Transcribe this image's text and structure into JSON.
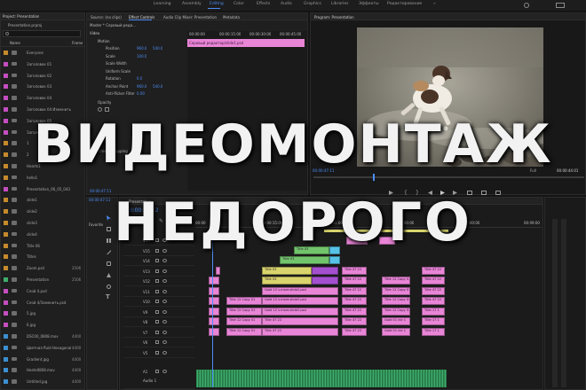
{
  "workspace_tabs": [
    "Learning",
    "Assembly",
    "Editing",
    "Color",
    "Effects",
    "Audio",
    "Graphics",
    "Libraries",
    "Эффекты",
    "Редактирование"
  ],
  "active_workspace": "Editing",
  "project": {
    "title": "Project: Presentation",
    "file": "Presentation.prproj",
    "column_name": "Name",
    "column_rate": "Frame",
    "items": [
      {
        "label": "Everyone",
        "color": "#c58a2b",
        "rate": ""
      },
      {
        "label": "Заголовок 01",
        "color": "#c44ec0",
        "rate": ""
      },
      {
        "label": "Заголовок 02",
        "color": "#c44ec0",
        "rate": ""
      },
      {
        "label": "Заголовок 03",
        "color": "#c44ec0",
        "rate": ""
      },
      {
        "label": "Заголовок 04",
        "color": "#c44ec0",
        "rate": ""
      },
      {
        "label": "Заголовок 04 Изменить",
        "color": "#c44ec0",
        "rate": ""
      },
      {
        "label": "Заголовок 05",
        "color": "#c44ec0",
        "rate": ""
      },
      {
        "label": "Заголовок 07",
        "color": "#c44ec0",
        "rate": ""
      },
      {
        "label": "1",
        "color": "#c58a2b",
        "rate": ""
      },
      {
        "label": "2",
        "color": "#c58a2b",
        "rate": ""
      },
      {
        "label": "Hearts1",
        "color": "#c58a2b",
        "rate": ""
      },
      {
        "label": "hello1",
        "color": "#c58a2b",
        "rate": ""
      },
      {
        "label": "Presentation_06_05_043",
        "color": "#c44ec0",
        "rate": ""
      },
      {
        "label": "slide1",
        "color": "#c58a2b",
        "rate": ""
      },
      {
        "label": "slide2",
        "color": "#c58a2b",
        "rate": ""
      },
      {
        "label": "slide3",
        "color": "#c58a2b",
        "rate": ""
      },
      {
        "label": "slide4",
        "color": "#c58a2b",
        "rate": ""
      },
      {
        "label": "Title 06",
        "color": "#c58a2b",
        "rate": ""
      },
      {
        "label": "Titles",
        "color": "#c58a2b",
        "rate": ""
      },
      {
        "label": "Zoom.psd",
        "color": "#c58a2b",
        "rate": "2506"
      },
      {
        "label": "Presentation",
        "color": "#3fae6a",
        "rate": "2506"
      },
      {
        "label": "Слой 4.psd",
        "color": "#c44ec0",
        "rate": ""
      },
      {
        "label": "Слой 4/Заменить.psd",
        "color": "#c44ec0",
        "rate": ""
      },
      {
        "label": "5.jpg",
        "color": "#c44ec0",
        "rate": ""
      },
      {
        "label": "6.jpg",
        "color": "#c44ec0",
        "rate": ""
      },
      {
        "label": "DSC00_0808.mov",
        "color": "#3c8fd0",
        "rate": "4400"
      },
      {
        "label": "Цветная fluid Hexagonal",
        "color": "#3c8fd0",
        "rate": "4400"
      },
      {
        "label": "Gradient.jpg",
        "color": "#3c8fd0",
        "rate": "4400"
      },
      {
        "label": "Hoste0808.mov",
        "color": "#3c8fd0",
        "rate": "4400"
      },
      {
        "label": "Untitled.jpg",
        "color": "#3c8fd0",
        "rate": "4400"
      }
    ]
  },
  "effect_controls": {
    "tabs": [
      "Source: (no clips)",
      "Effect Controls",
      "Audio Clip Mixer: Presentation",
      "Metadata"
    ],
    "active_tab": "Effect Controls",
    "master": "Master * Серовый реда...",
    "section_video": "Video",
    "section_motion": "Motion",
    "rows": [
      {
        "label": "Position",
        "values": [
          "960.0",
          "540.0"
        ]
      },
      {
        "label": "Scale",
        "values": [
          "100.0",
          ""
        ]
      },
      {
        "label": "Scale Width",
        "values": [
          "",
          ""
        ]
      },
      {
        "label": "Uniform Scale",
        "values": [
          "",
          ""
        ]
      },
      {
        "label": "Rotation",
        "values": [
          "0.0",
          ""
        ]
      },
      {
        "label": "Anchor Point",
        "values": [
          "960.0",
          "540.0"
        ]
      },
      {
        "label": "Anti-flicker Filter",
        "values": [
          "0.00",
          ""
        ]
      }
    ],
    "section_opacity": "Opacity",
    "section_time": "Time Remapping",
    "ruler": [
      "00:00:00",
      "00:00:15:00",
      "00:00:30:00",
      "00:00:45:00"
    ],
    "clip_name": "Серовый редактор/slide1.psd",
    "timecode": "00:00:47:11"
  },
  "program": {
    "title": "Program: Presentation",
    "timecode_left": "00:00:47:11",
    "fit": "Full",
    "timecode_right": "00:00:44:01"
  },
  "timeline": {
    "tab": "Presentation",
    "timecode": "00:00:47:12",
    "ruler": [
      "00:00",
      "00:00:15:00",
      "00:01:00:00",
      "00:02:00:00",
      "00:07:00:00",
      "00:09:00"
    ],
    "tracks": [
      "V16",
      "V15",
      "V14",
      "V13",
      "V12",
      "V11",
      "V10",
      "V9",
      "V8",
      "V7",
      "V6",
      "V5",
      "A1"
    ],
    "audio_label": "Audio 1",
    "clips_v": [
      {
        "label": "Title 47 22",
        "color": "pink"
      },
      {
        "label": "Title 03",
        "color": "yellow"
      },
      {
        "label": "Title 12 Copy 01",
        "color": "pink"
      },
      {
        "label": "Gold 12 v.more.slide2.psd",
        "color": "pink"
      },
      {
        "label": "Gold 12 v.more.slide2.psd",
        "color": "pink"
      },
      {
        "label": "Title 12 Copy 03",
        "color": "pink"
      },
      {
        "label": "Title 12 Copy 03",
        "color": "pink"
      },
      {
        "label": "Title 17 1",
        "color": "pink"
      },
      {
        "label": "Title 12 Copy 01",
        "color": "pink"
      },
      {
        "label": "Gold 01 nle 1",
        "color": "pink"
      }
    ]
  },
  "overlay": {
    "line1": "ВИДЕОМОНТАЖ",
    "line2": "НЕДОРОГО"
  }
}
